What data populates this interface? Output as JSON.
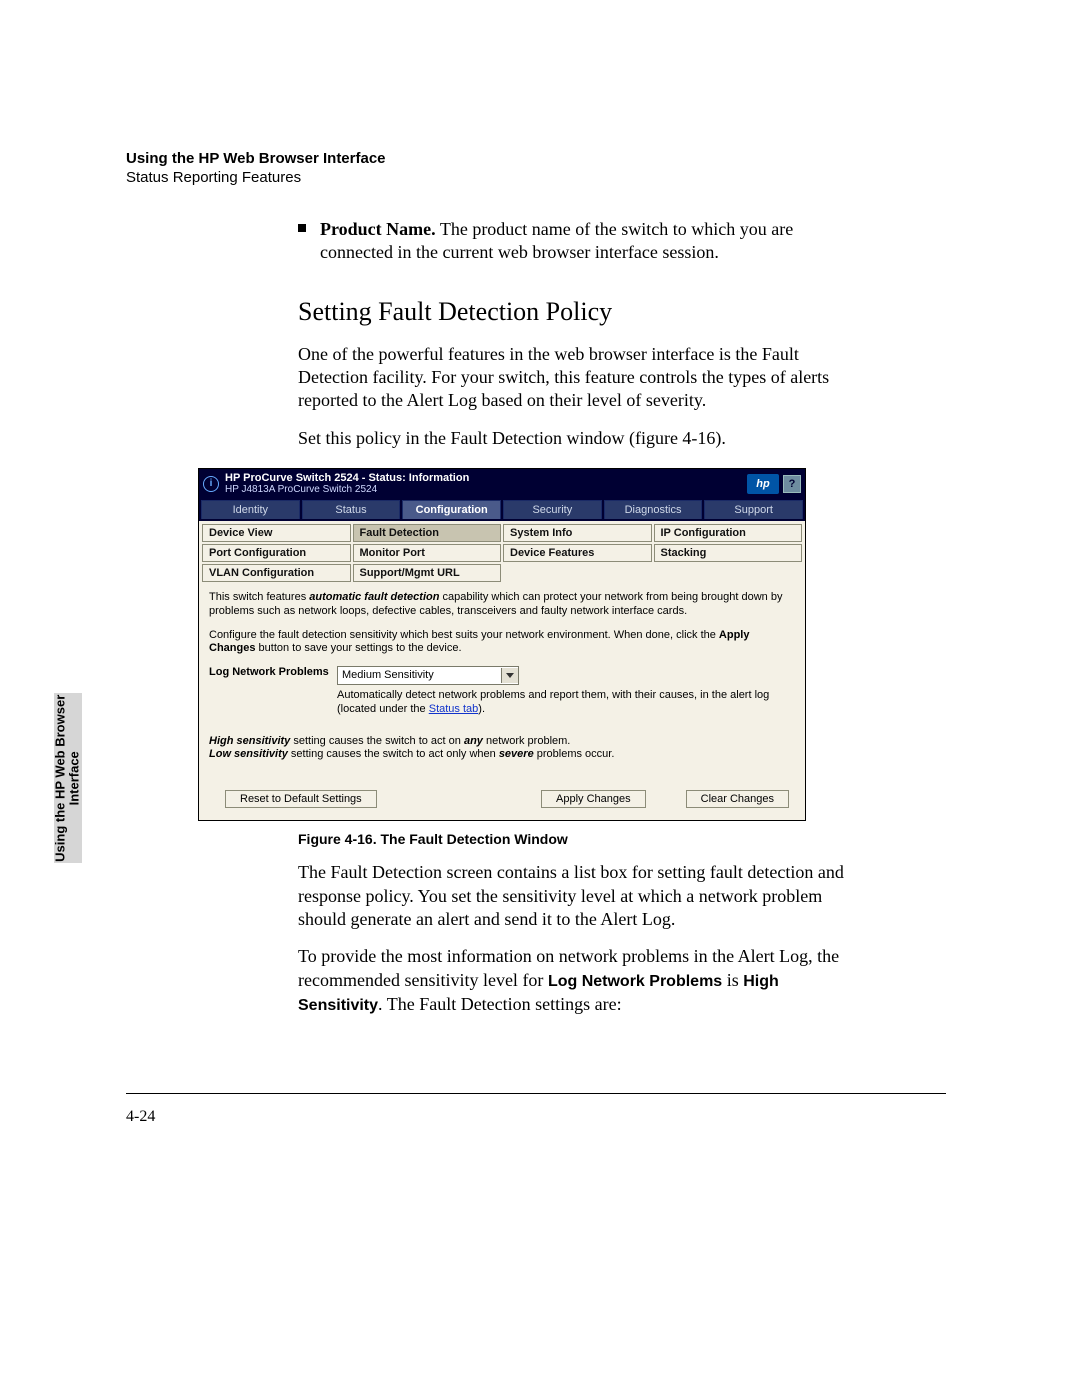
{
  "header": {
    "chapter": "Using the HP Web Browser Interface",
    "section": "Status Reporting Features"
  },
  "side_tab": {
    "line1": "Using the HP Web Browser",
    "line2": "Interface"
  },
  "bullet": {
    "label": "Product Name.",
    "text": " The product name of the switch to which you are connected in the current web browser interface session."
  },
  "h2": "Setting Fault Detection Policy",
  "para1": "One of the powerful features in the web browser interface is the Fault Detection facility. For your switch, this feature controls the types of alerts reported to the Alert Log based on their level of severity.",
  "para2": "Set this policy in the Fault Detection window (figure 4-16).",
  "figure": {
    "titlebar_title": "HP ProCurve Switch 2524 - Status: Information",
    "titlebar_sub": "HP J4813A ProCurve Switch 2524",
    "tabs": [
      "Identity",
      "Status",
      "Configuration",
      "Security",
      "Diagnostics",
      "Support"
    ],
    "active_tab": "Configuration",
    "subtabs": [
      "Device View",
      "Fault Detection",
      "System Info",
      "IP Configuration",
      "Port Configuration",
      "Monitor Port",
      "Device Features",
      "Stacking",
      "VLAN Configuration",
      "Support/Mgmt URL",
      "",
      ""
    ],
    "active_subtab": "Fault Detection",
    "body_p1a": "This switch features ",
    "body_p1b": "automatic fault detection",
    "body_p1c": " capability which can protect your network from being brought down by problems such as network loops, defective cables, transceivers and faulty network interface cards.",
    "body_p2a": "Configure the fault detection sensitivity which best suits your network environment. When done, click the ",
    "body_p2b": "Apply Changes",
    "body_p2c": " button to save your settings to the device.",
    "log_label": "Log Network Problems",
    "dropdown_value": "Medium Sensitivity",
    "auto_text_a": "Automatically detect network problems and report them, with their causes, in the alert log (located under the ",
    "auto_text_link": "Status tab",
    "auto_text_b": ").",
    "sens_high_a": "High sensitivity",
    "sens_high_b": " setting causes the switch to act on ",
    "sens_high_c": "any",
    "sens_high_d": " network problem.",
    "sens_low_a": "Low sensitivity",
    "sens_low_b": " setting causes the switch to act only when ",
    "sens_low_c": "severe",
    "sens_low_d": " problems occur.",
    "btn_reset": "Reset to Default Settings",
    "btn_apply": "Apply Changes",
    "btn_clear": "Clear Changes"
  },
  "caption": "Figure 4-16.  The Fault Detection Window",
  "after1": "The Fault Detection screen contains a list box for setting fault detection and response policy. You set the sensitivity level at which a network problem should generate an alert and send it to the Alert Log.",
  "after2a": "To provide the most information on network problems in the Alert Log, the recommended sensitivity level for ",
  "after2b": "Log Network Problems",
  "after2c": " is ",
  "after2d": "High Sensitivity",
  "after2e": ". The Fault Detection settings are:",
  "page_number": "4-24"
}
